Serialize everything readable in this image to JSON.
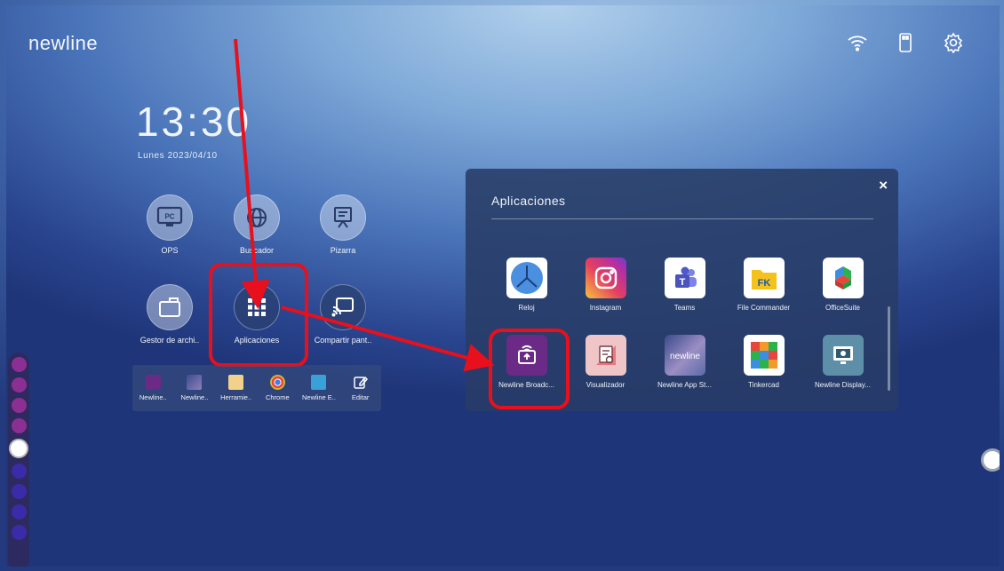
{
  "brand": "newline",
  "clock": {
    "time": "13:30",
    "date": "Lunes  2023/04/10"
  },
  "home_tiles": [
    {
      "label": "OPS"
    },
    {
      "label": "Buscador"
    },
    {
      "label": "Pizarra"
    },
    {
      "label": "Gestor de archi.."
    },
    {
      "label": "Aplicaciones"
    },
    {
      "label": "Compartir pant.."
    }
  ],
  "dock": [
    {
      "label": "Newline.."
    },
    {
      "label": "Newline.."
    },
    {
      "label": "Herramie.."
    },
    {
      "label": "Chrome"
    },
    {
      "label": "Newline E.."
    },
    {
      "label": "Editar"
    }
  ],
  "panel": {
    "title": "Aplicaciones",
    "close": "×",
    "apps": [
      {
        "label": "Reloj"
      },
      {
        "label": "Instagram"
      },
      {
        "label": "Teams"
      },
      {
        "label": "File Commander"
      },
      {
        "label": "OfficeSuite"
      },
      {
        "label": "Newline Broadc..."
      },
      {
        "label": "Visualizador"
      },
      {
        "label": "Newline App St..."
      },
      {
        "label": "Tinkercad"
      },
      {
        "label": "Newline Display..."
      }
    ]
  },
  "icon_text": {
    "pc": "PC",
    "fk": "FK",
    "teams": "T",
    "newline_mini": "newline",
    "tinkercad": "TIN KER CAD"
  },
  "colors": {
    "highlight": "#e8101c",
    "accent_purple": "#6a2a86"
  }
}
